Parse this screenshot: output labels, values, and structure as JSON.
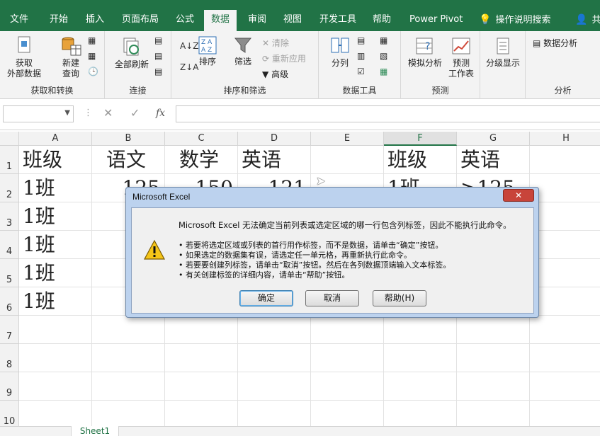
{
  "ribbon_tabs": [
    {
      "label": "文件"
    },
    {
      "label": "开始"
    },
    {
      "label": "插入"
    },
    {
      "label": "页面布局"
    },
    {
      "label": "公式"
    },
    {
      "label": "数据"
    },
    {
      "label": "审阅"
    },
    {
      "label": "视图"
    },
    {
      "label": "开发工具"
    },
    {
      "label": "帮助"
    },
    {
      "label": "Power Pivot"
    },
    {
      "label": "操作说明搜索"
    },
    {
      "label": "共"
    }
  ],
  "active_tab": "数据",
  "ribbon": {
    "get_external": "获取\n外部数据",
    "new_query": "新建\n查询",
    "get_transform": "获取和转换",
    "refresh_all": "全部刷新",
    "connections": "连接",
    "sort": "排序",
    "filter": "筛选",
    "clear": "清除",
    "reapply": "重新应用",
    "advanced": "高级",
    "sort_filter": "排序和筛选",
    "text_to_columns": "分列",
    "data_tools": "数据工具",
    "what_if": "模拟分析",
    "forecast_sheet": "预测\n工作表",
    "forecast": "预测",
    "outline": "分级显示",
    "data_analysis": "数据分析",
    "analysis": "分析"
  },
  "formula_bar": {
    "name_box": "",
    "formula": "",
    "fx": "fx"
  },
  "grid": {
    "columns": [
      "A",
      "B",
      "C",
      "D",
      "E",
      "F",
      "G",
      "H"
    ],
    "rows": [
      "1",
      "2",
      "3",
      "4",
      "5",
      "6",
      "7",
      "8",
      "9",
      "10"
    ],
    "cells": {
      "A1": "班级",
      "B1": "语文",
      "C1": "数学",
      "D1": "英语",
      "F1": "班级",
      "G1": "英语",
      "A2": "1班",
      "B2": "125",
      "C2": "150",
      "D2": "121",
      "F2": "1班",
      "G2": ">125",
      "A3": "1班",
      "A4": "1班",
      "A5": "1班",
      "A6": "1班"
    }
  },
  "sheet_tab": "Sheet1",
  "dialog": {
    "title": "Microsoft Excel",
    "close": "✕",
    "message": "Microsoft Excel 无法确定当前列表或选定区域的哪一行包含列标签，因此不能执行此命令。",
    "bullets": [
      "• 若要将选定区域或列表的首行用作标签，而不是数据，请单击“确定”按钮。",
      "• 如果选定的数据集有误，请选定任一单元格，再重新执行此命令。",
      "• 若要要创建列标签，请单击“取消”按钮。然后在各列数据顶端输入文本标签。",
      "• 有关创建标签的详细内容，请单击“帮助”按钮。"
    ],
    "ok": "确定",
    "cancel": "取消",
    "help": "帮助(H)"
  }
}
